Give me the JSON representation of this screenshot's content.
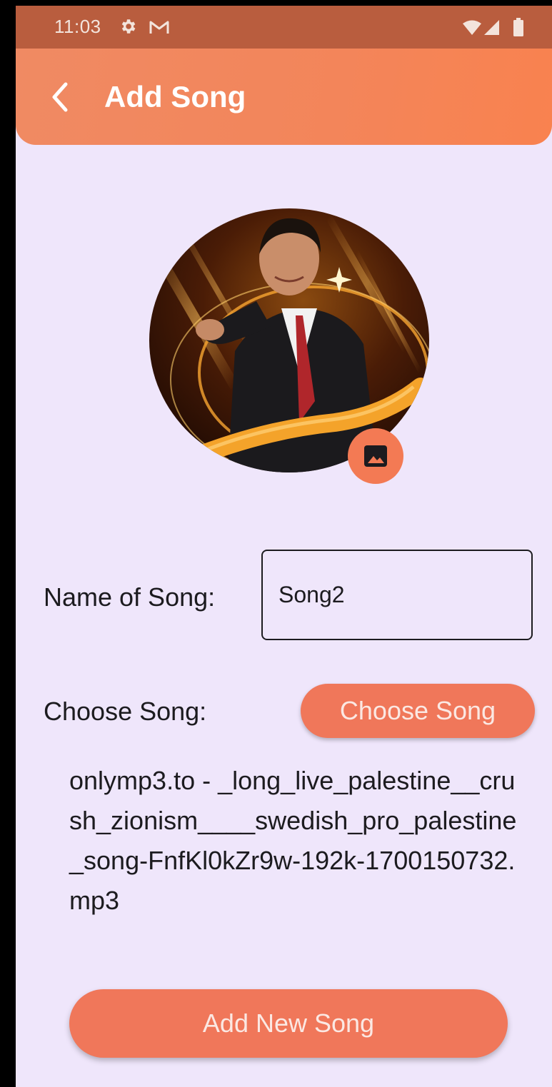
{
  "status_bar": {
    "time": "11:03",
    "icons": [
      "gear-icon",
      "gmail-icon",
      "wifi-icon",
      "signal-icon",
      "battery-icon"
    ]
  },
  "app_bar": {
    "title": "Add Song",
    "back_icon": "chevron-left-icon"
  },
  "artwork": {
    "edit_icon": "image-icon"
  },
  "form": {
    "name_label": "Name of Song:",
    "name_value": "Song2",
    "choose_label": "Choose Song:",
    "choose_button": "Choose Song",
    "selected_file": "onlymp3.to - _long_live_palestine__crush_zionism____swedish_pro_palestine_song-FnfKl0kZr9w-192k-1700150732.mp3"
  },
  "actions": {
    "add_button": "Add New Song"
  },
  "colors": {
    "accent": "#f0775a",
    "app_bar": "#f3855a",
    "background": "#efe6fb",
    "status_bar": "#b95d3e"
  }
}
